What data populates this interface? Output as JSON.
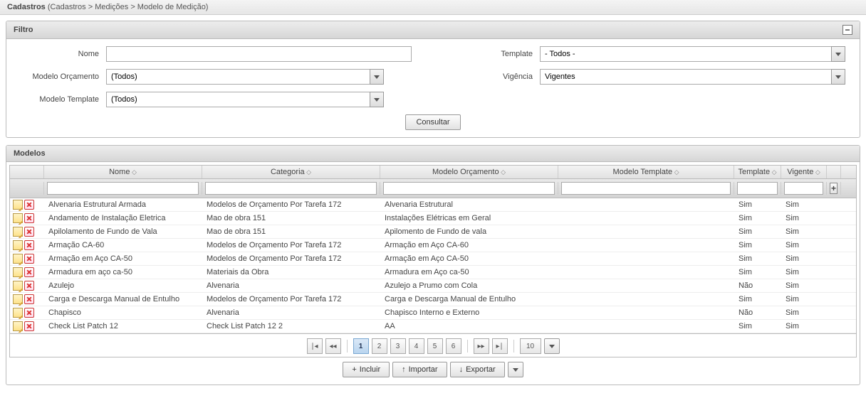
{
  "breadcrumb": {
    "title": "Cadastros",
    "path": "(Cadastros > Medições > Modelo de Medição)"
  },
  "filter": {
    "title": "Filtro",
    "labels": {
      "nome": "Nome",
      "modelo_orc": "Modelo Orçamento",
      "modelo_tpl": "Modelo Template",
      "template": "Template",
      "vigencia": "Vigência"
    },
    "values": {
      "nome": "",
      "modelo_orc": "(Todos)",
      "modelo_tpl": "(Todos)",
      "template": "- Todos -",
      "vigencia": "Vigentes"
    },
    "consultar": "Consultar"
  },
  "grid": {
    "title": "Modelos",
    "headers": {
      "nome": "Nome",
      "categoria": "Categoria",
      "modelo_orc": "Modelo Orçamento",
      "modelo_tpl": "Modelo Template",
      "template": "Template",
      "vigente": "Vigente"
    },
    "rows": [
      {
        "nome": "Alvenaria Estrutural Armada",
        "categoria": "Modelos de Orçamento Por Tarefa 172",
        "modelo_orc": "Alvenaria Estrutural",
        "modelo_tpl": "",
        "template": "Sim",
        "vigente": "Sim"
      },
      {
        "nome": "Andamento de Instalação Eletrica",
        "categoria": "Mao de obra 151",
        "modelo_orc": "Instalações Elétricas em Geral",
        "modelo_tpl": "",
        "template": "Sim",
        "vigente": "Sim"
      },
      {
        "nome": "Apilolamento de Fundo de Vala",
        "categoria": "Mao de obra 151",
        "modelo_orc": "Apilomento de Fundo de vala",
        "modelo_tpl": "",
        "template": "Sim",
        "vigente": "Sim"
      },
      {
        "nome": "Armação CA-60",
        "categoria": "Modelos de Orçamento Por Tarefa 172",
        "modelo_orc": "Armação em Aço CA-60",
        "modelo_tpl": "",
        "template": "Sim",
        "vigente": "Sim"
      },
      {
        "nome": "Armação em Aço CA-50",
        "categoria": "Modelos de Orçamento Por Tarefa 172",
        "modelo_orc": "Armação em Aço CA-50",
        "modelo_tpl": "",
        "template": "Sim",
        "vigente": "Sim"
      },
      {
        "nome": "Armadura em aço ca-50",
        "categoria": "Materiais da Obra",
        "modelo_orc": "Armadura em Aço ca-50",
        "modelo_tpl": "",
        "template": "Sim",
        "vigente": "Sim"
      },
      {
        "nome": "Azulejo",
        "categoria": "Alvenaria",
        "modelo_orc": "Azulejo a Prumo com Cola",
        "modelo_tpl": "",
        "template": "Não",
        "vigente": "Sim"
      },
      {
        "nome": "Carga e Descarga Manual de Entulho",
        "categoria": "Modelos de Orçamento Por Tarefa 172",
        "modelo_orc": "Carga e Descarga Manual de Entulho",
        "modelo_tpl": "",
        "template": "Sim",
        "vigente": "Sim"
      },
      {
        "nome": "Chapisco",
        "categoria": "Alvenaria",
        "modelo_orc": "Chapisco Interno e Externo",
        "modelo_tpl": "",
        "template": "Não",
        "vigente": "Sim"
      },
      {
        "nome": "Check List Patch 12",
        "categoria": "Check List Patch 12 2",
        "modelo_orc": "AA",
        "modelo_tpl": "",
        "template": "Sim",
        "vigente": "Sim"
      }
    ]
  },
  "pager": {
    "pages": [
      "1",
      "2",
      "3",
      "4",
      "5",
      "6"
    ],
    "active": "1",
    "page_size": "10"
  },
  "actions": {
    "incluir": "Incluir",
    "importar": "Importar",
    "exportar": "Exportar"
  }
}
